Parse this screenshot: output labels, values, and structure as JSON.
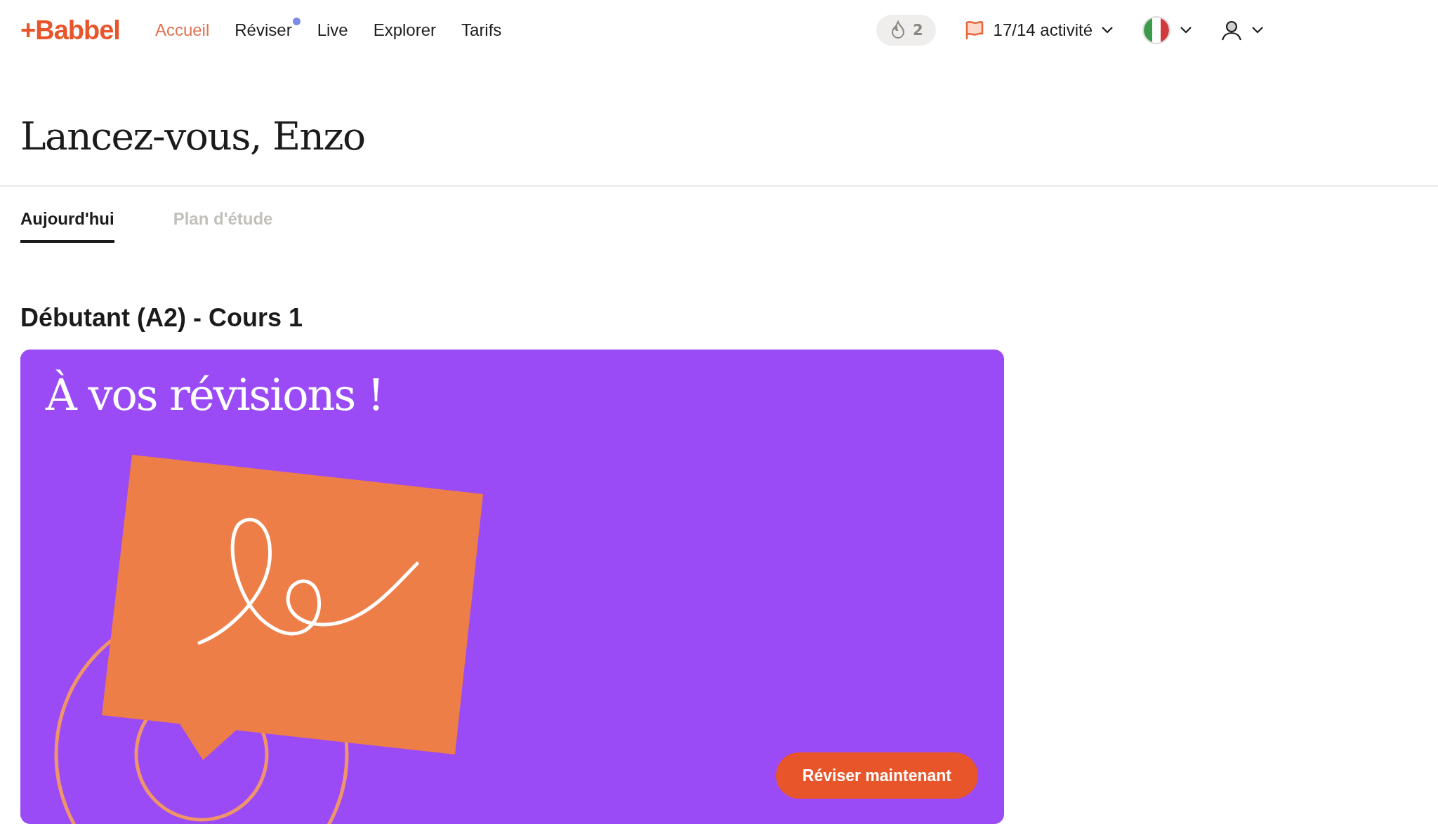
{
  "header": {
    "logo": "+Babbel",
    "nav": [
      {
        "label": "Accueil",
        "selected": true,
        "dot": false
      },
      {
        "label": "Réviser",
        "selected": false,
        "dot": true
      },
      {
        "label": "Live",
        "selected": false,
        "dot": false
      },
      {
        "label": "Explorer",
        "selected": false,
        "dot": false
      },
      {
        "label": "Tarifs",
        "selected": false,
        "dot": false
      }
    ],
    "streak": "2",
    "activity": "17/14 activité"
  },
  "page_title": "Lancez-vous, Enzo",
  "tabs": [
    {
      "label": "Aujourd'hui",
      "selected": true
    },
    {
      "label": "Plan d'étude",
      "selected": false
    }
  ],
  "course_heading": "Débutant (A2) - Cours 1",
  "review_card": {
    "title": "À vos révisions !",
    "button": "Réviser maintenant"
  }
}
